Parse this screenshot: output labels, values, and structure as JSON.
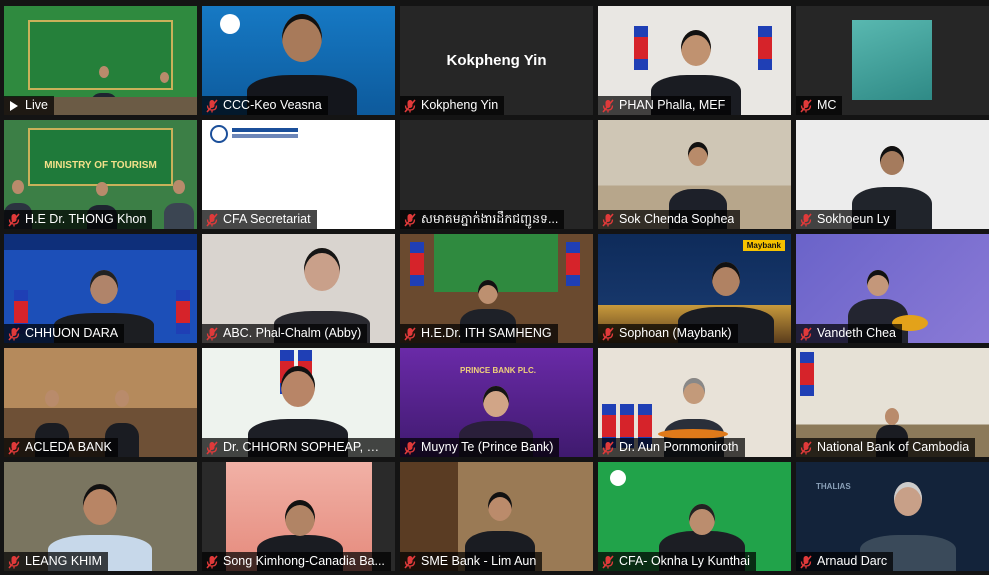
{
  "meeting": {
    "tiles": [
      {
        "name": "Live",
        "theme": "ministry-live",
        "active": true
      },
      {
        "name": "CCC-Keo Veasna",
        "theme": "blue-logo-man"
      },
      {
        "name": "Kokpheng Yin",
        "theme": "black-name",
        "center_label": "Kokpheng Yin"
      },
      {
        "name": "PHAN Phalla, MEF",
        "theme": "flags-man"
      },
      {
        "name": "MC",
        "theme": "black-thumb"
      },
      {
        "name": "H.E Dr. THONG Khon",
        "theme": "ministry-room",
        "banner_text": "MINISTRY OF TOURISM"
      },
      {
        "name": "CFA Secretariat",
        "theme": "white-logo"
      },
      {
        "name": "សមាគមភ្នាក់ងារដឹកជញ្ជូនទ...",
        "theme": "black-empty"
      },
      {
        "name": "Sok Chenda Sophea",
        "theme": "office-man"
      },
      {
        "name": "Sokhoeun Ly",
        "theme": "white-wall-man"
      },
      {
        "name": "CHHUON DARA",
        "theme": "blue-banner-man"
      },
      {
        "name": "ABC. Phal-Chalm (Abby)",
        "theme": "woman-glasses"
      },
      {
        "name": "H.E.Dr. ITH SAMHENG",
        "theme": "flags-green-man"
      },
      {
        "name": "Sophoan (Maybank)",
        "theme": "maybank-man"
      },
      {
        "name": "Vandeth Chea",
        "theme": "purple-map-man"
      },
      {
        "name": "ACLEDA BANK",
        "theme": "wood-room"
      },
      {
        "name": "Dr. CHHORN SOPHEAP, MEF",
        "theme": "green-white-man"
      },
      {
        "name": "Muyny Te (Prince Bank)",
        "theme": "prince-woman"
      },
      {
        "name": "Dr. Aun Pornmoniroth",
        "theme": "beige-flags-man"
      },
      {
        "name": "National Bank of Cambodia",
        "theme": "nbc-room"
      },
      {
        "name": "LEANG KHIM",
        "theme": "olive-man"
      },
      {
        "name": "Song Kimhong-Canadia Ba...",
        "theme": "red-map-man"
      },
      {
        "name": "SME Bank - Lim Aun",
        "theme": "wood-shelf-man"
      },
      {
        "name": "CFA- Oknha Ly Kunthai",
        "theme": "green-man"
      },
      {
        "name": "Arnaud Darc",
        "theme": "navy-thalias-man"
      }
    ]
  },
  "logos": {
    "maybank": "Maybank",
    "prince_bank": "PRINCE BANK PLC.",
    "thalias": "THALIAS"
  },
  "colors": {
    "active_border": "#e6d700",
    "muted_mic": "#e03a3a",
    "name_bar": "rgba(0,0,0,0.72)"
  },
  "icons": {
    "mic": "muted-microphone-icon"
  }
}
